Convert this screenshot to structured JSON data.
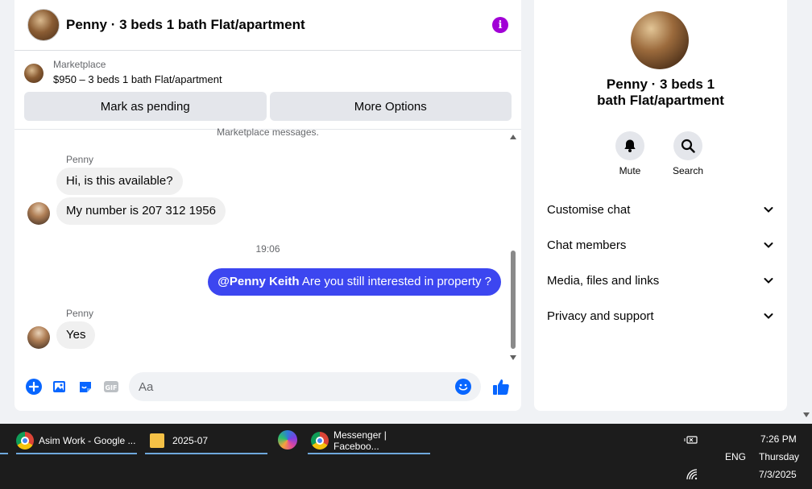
{
  "chat": {
    "title": "Penny · 3 beds 1 bath Flat/apartment",
    "marketplace": {
      "label": "Marketplace",
      "listing": "$950 – 3 beds 1 bath Flat/apartment",
      "mark_pending": "Mark as pending",
      "more_options": "More Options"
    },
    "note": "Marketplace messages.",
    "messages": [
      {
        "sender": "Penny",
        "text": "Hi, is this available?"
      },
      {
        "text": "My number is 207 312 1956"
      },
      {
        "timestamp": "19:06"
      },
      {
        "mention": "@Penny Keith",
        "text": "Are you still interested in property ?"
      },
      {
        "sender": "Penny",
        "text": "Yes"
      }
    ],
    "composer_placeholder": "Aa"
  },
  "side": {
    "title": "Penny · 3 beds 1 bath Flat/apartment",
    "actions": [
      {
        "label": "Mute",
        "icon": "bell-icon"
      },
      {
        "label": "Search",
        "icon": "search-icon"
      }
    ],
    "sections": [
      "Customise chat",
      "Chat members",
      "Media, files and links",
      "Privacy and support"
    ]
  },
  "taskbar": {
    "tasks": [
      {
        "label": "Asim Work - Google ..."
      },
      {
        "label": "2025-07"
      },
      {
        "label": "Messenger | Faceboo..."
      }
    ],
    "lang": "ENG",
    "time": "7:26 PM",
    "day": "Thursday",
    "date": "7/3/2025"
  },
  "colors": {
    "accent": "#3c46f0",
    "info": "#a100d6",
    "messenger_blue": "#0866ff"
  }
}
